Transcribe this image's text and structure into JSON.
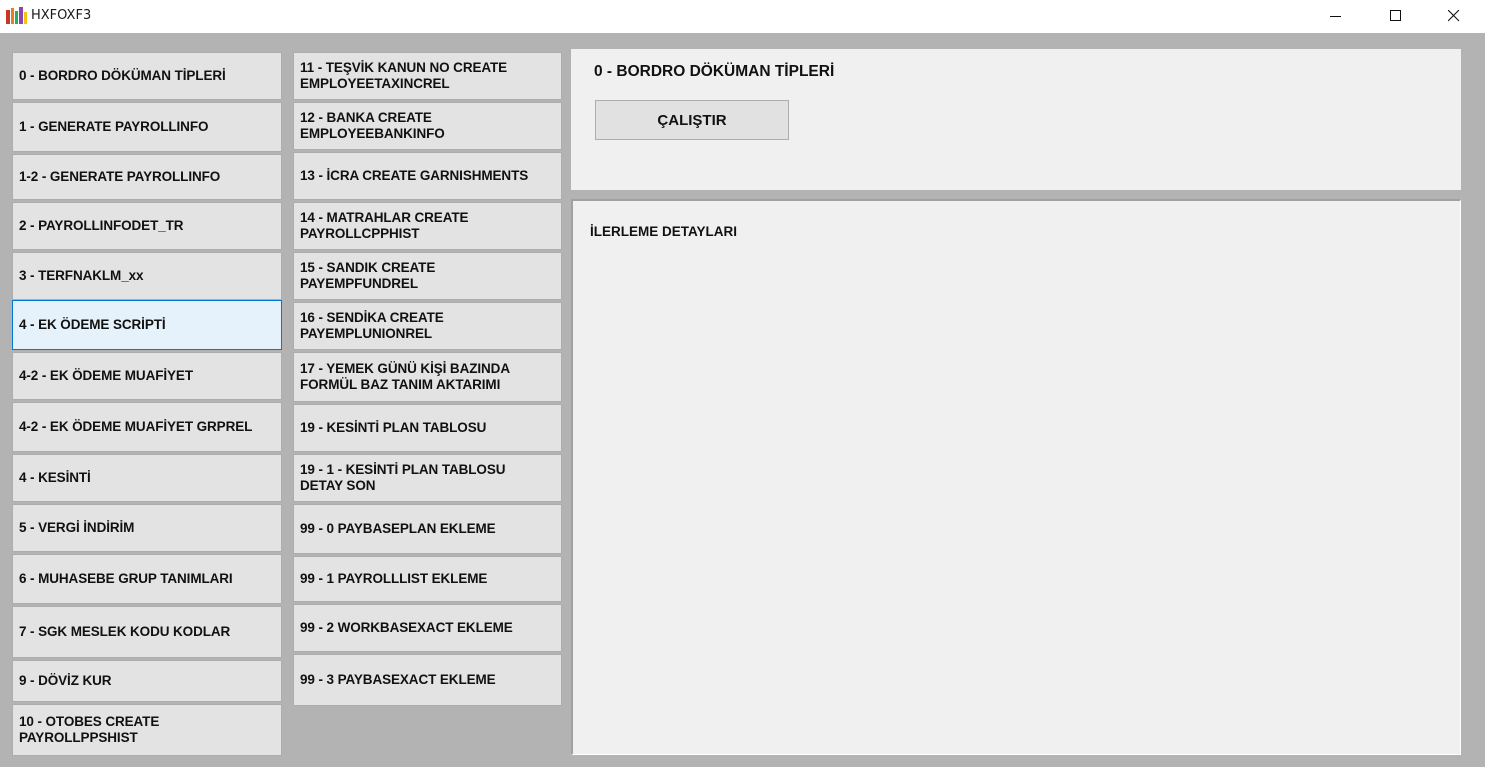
{
  "window": {
    "title": "HXFOXF3"
  },
  "left_column": [
    "0 - BORDRO DÖKÜMAN TİPLERİ",
    "1 - GENERATE PAYROLLINFO",
    "1-2 - GENERATE PAYROLLINFO",
    "2 - PAYROLLINFODET_TR",
    "3 - TERFNAKLM_xx",
    "4 - EK ÖDEME SCRİPTİ",
    "4-2 - EK ÖDEME MUAFİYET",
    "4-2 - EK ÖDEME MUAFİYET GRPREL",
    "4 - KESİNTİ",
    "5 - VERGİ İNDİRİM",
    "6 - MUHASEBE GRUP TANIMLARI",
    "7 - SGK MESLEK KODU KODLAR",
    "9 - DÖVİZ KUR",
    [
      "10 - OTOBES CREATE",
      "PAYROLLPPSHIST"
    ]
  ],
  "right_column": [
    [
      "11 - TEŞVİK KANUN NO CREATE",
      "EMPLOYEETAXINCREL"
    ],
    [
      "12 - BANKA CREATE",
      "EMPLOYEEBANKINFO"
    ],
    "13 - İCRA CREATE GARNISHMENTS",
    [
      "14 - MATRAHLAR CREATE",
      "PAYROLLCPPHIST"
    ],
    [
      "15 - SANDIK CREATE",
      "PAYEMPFUNDREL"
    ],
    [
      "16 - SENDİKA CREATE",
      "PAYEMPLUNIONREL"
    ],
    [
      "17 - YEMEK GÜNÜ KİŞİ BAZINDA",
      "FORMÜL BAZ TANIM AKTARIMI"
    ],
    "19 - KESİNTİ PLAN TABLOSU",
    [
      "19 - 1 - KESİNTİ PLAN TABLOSU",
      "DETAY SON"
    ],
    "99 - 0 PAYBASEPLAN EKLEME",
    "99 - 1 PAYROLLLIST EKLEME",
    "99 - 2 WORKBASEXACT EKLEME",
    "99 - 3 PAYBASEXACT EKLEME"
  ],
  "selected_index": 5,
  "main": {
    "selected_title": "0 - BORDRO DÖKÜMAN TİPLERİ",
    "run_label": "ÇALIŞTIR",
    "progress_label": "İLERLEME DETAYLARI"
  }
}
